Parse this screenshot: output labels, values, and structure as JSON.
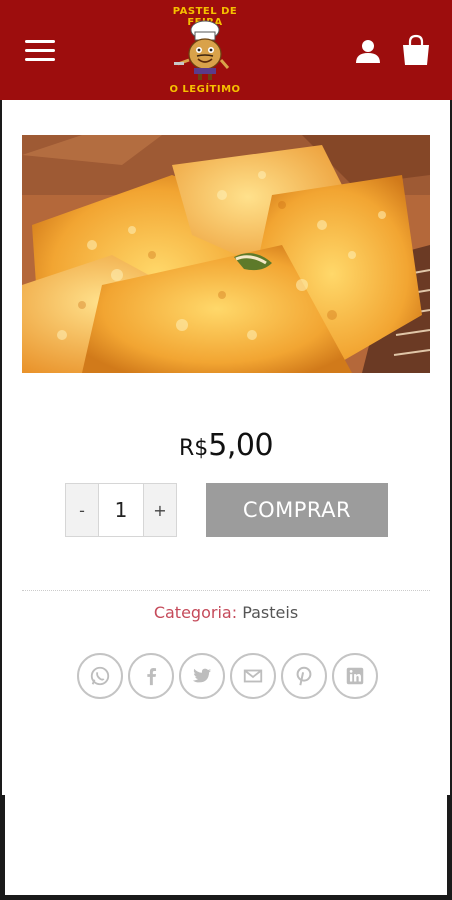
{
  "header": {
    "logo_top_text": "PASTEL DE FEIRA",
    "logo_bottom_text": "O LEGÍTIMO",
    "menu_icon": "hamburger-menu-icon",
    "account_icon": "user-icon",
    "cart_icon": "shopping-bag-icon",
    "background_color": "#9d0d0d"
  },
  "product": {
    "image_alt": "pastel",
    "price_currency": "R$",
    "price_amount": "5,00",
    "quantity": "1",
    "decrement_label": "-",
    "increment_label": "+",
    "buy_label": "COMPRAR",
    "buy_button_color": "#9c9c9c"
  },
  "meta": {
    "category_label": "Categoria:",
    "category_value": "Pasteis"
  },
  "share_icons": [
    "whatsapp-icon",
    "facebook-icon",
    "twitter-icon",
    "email-icon",
    "pinterest-icon",
    "linkedin-icon"
  ]
}
